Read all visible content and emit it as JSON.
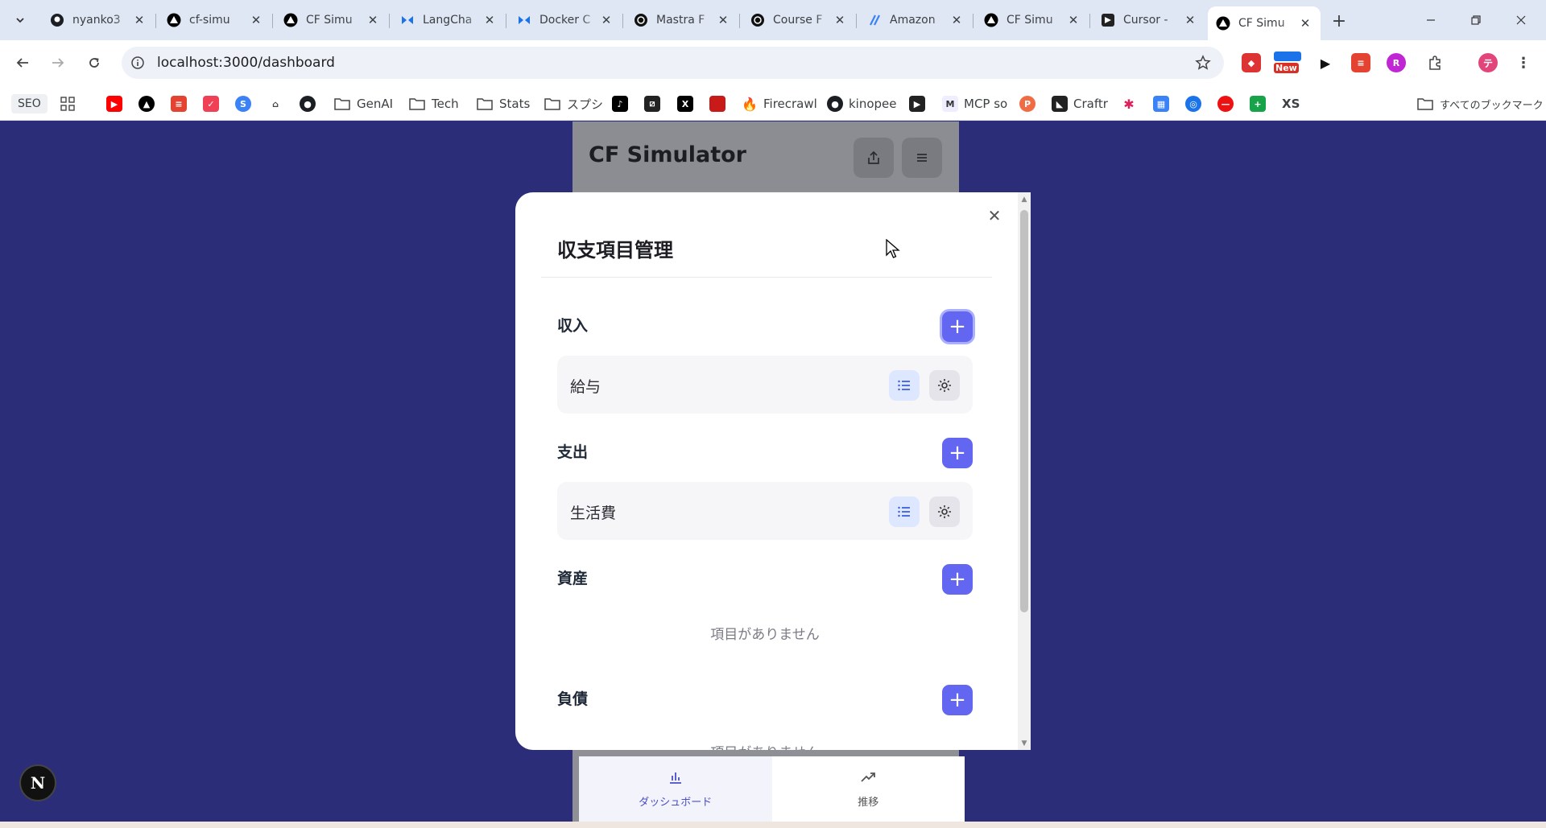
{
  "browser": {
    "tabs": [
      {
        "label": "nyanko3",
        "icon": "github-icon"
      },
      {
        "label": "cf-simu",
        "icon": "vercel-icon"
      },
      {
        "label": "CF Simu",
        "icon": "vercel-icon"
      },
      {
        "label": "LangCha",
        "icon": "langchain-icon"
      },
      {
        "label": "Docker C",
        "icon": "docker-icon"
      },
      {
        "label": "Mastra F",
        "icon": "mastra-icon"
      },
      {
        "label": "Course F",
        "icon": "course-icon"
      },
      {
        "label": "Amazon",
        "icon": "amazon-icon"
      },
      {
        "label": "CF Simu",
        "icon": "vercel-icon"
      },
      {
        "label": "Cursor -",
        "icon": "cursor-icon"
      },
      {
        "label": "CF Simu",
        "icon": "vercel-icon",
        "active": true
      }
    ],
    "url": "localhost:3000/dashboard",
    "new_badge": "New",
    "profile_initial": "テ",
    "bookmarks": [
      {
        "label": "SEO"
      },
      {
        "label": "GenAI",
        "folder": true
      },
      {
        "label": "Tech",
        "folder": true
      },
      {
        "label": "Stats",
        "folder": true
      },
      {
        "label": "スプシ",
        "folder": true
      },
      {
        "label": "Firecrawl"
      },
      {
        "label": "kinopee"
      },
      {
        "label": "MCP so"
      },
      {
        "label": "Craftr"
      },
      {
        "label": "XS"
      },
      {
        "label": "すべてのブックマーク",
        "folder": true
      }
    ]
  },
  "app": {
    "title": "CF Simulator",
    "bottom_nav": [
      {
        "label": "ダッシュボード",
        "icon": "bar-chart-icon",
        "active": true
      },
      {
        "label": "推移",
        "icon": "trend-icon"
      }
    ],
    "next_badge": "N"
  },
  "modal": {
    "title": "収支項目管理",
    "close_icon": "close-icon",
    "sections": [
      {
        "label": "収入",
        "items": [
          {
            "name": "給与"
          }
        ],
        "empty_text": ""
      },
      {
        "label": "支出",
        "items": [
          {
            "name": "生活費"
          }
        ],
        "empty_text": ""
      },
      {
        "label": "資産",
        "items": [],
        "empty_text": "項目がありません"
      },
      {
        "label": "負債",
        "items": [],
        "empty_text": "項目がありません"
      }
    ]
  },
  "colors": {
    "accent": "#6366f1",
    "page_bg": "#2b2d78",
    "overlay_app": "#8f9096",
    "list_btn_bg": "#dde7ff"
  }
}
